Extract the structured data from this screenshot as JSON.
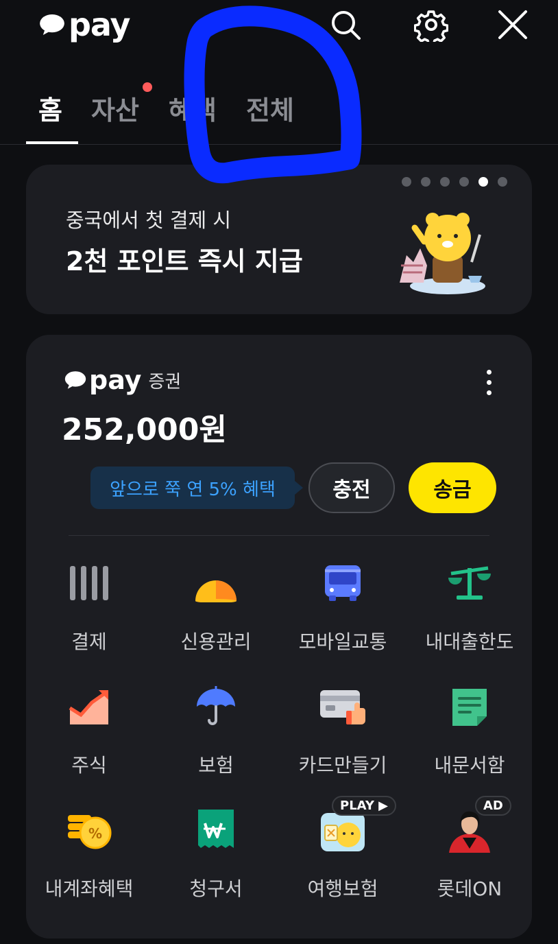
{
  "header": {
    "logo_text": "pay",
    "icons": [
      "search-icon",
      "gear-icon",
      "close-icon"
    ]
  },
  "tabs": [
    {
      "label": "홈",
      "active": true
    },
    {
      "label": "자산",
      "active": false,
      "has_dot": true
    },
    {
      "label": "혜택",
      "active": false
    },
    {
      "label": "전체",
      "active": false
    }
  ],
  "banner": {
    "subtitle": "중국에서 첫 결제 시",
    "title": "2천 포인트 즉시 지급",
    "page_count": 6,
    "active_page": 5
  },
  "securities": {
    "brand": "pay",
    "tag": "증권",
    "balance": "252,000원",
    "promo_tooltip": "앞으로 쭉 연 5% 혜택",
    "charge_label": "충전",
    "send_label": "송금"
  },
  "menu": [
    {
      "label": "결제",
      "icon": "barcode-icon"
    },
    {
      "label": "신용관리",
      "icon": "credit-score-icon"
    },
    {
      "label": "모바일교통",
      "icon": "bus-icon"
    },
    {
      "label": "내대출한도",
      "icon": "scale-icon"
    },
    {
      "label": "주식",
      "icon": "stock-chart-icon"
    },
    {
      "label": "보험",
      "icon": "umbrella-icon"
    },
    {
      "label": "카드만들기",
      "icon": "card-icon"
    },
    {
      "label": "내문서함",
      "icon": "document-icon"
    },
    {
      "label": "내계좌혜택",
      "icon": "coins-icon"
    },
    {
      "label": "청구서",
      "icon": "bill-icon"
    },
    {
      "label": "여행보험",
      "icon": "travel-insurance-icon",
      "badge": "PLAY"
    },
    {
      "label": "롯데ON",
      "icon": "lotteon-ad-icon",
      "badge": "AD"
    }
  ],
  "colors": {
    "background": "#0e0f12",
    "card": "#1c1d22",
    "accent_yellow": "#fee500",
    "tooltip_text": "#3ca2ff",
    "notification_dot": "#ff5b5b",
    "scribble": "#0a2bff"
  }
}
